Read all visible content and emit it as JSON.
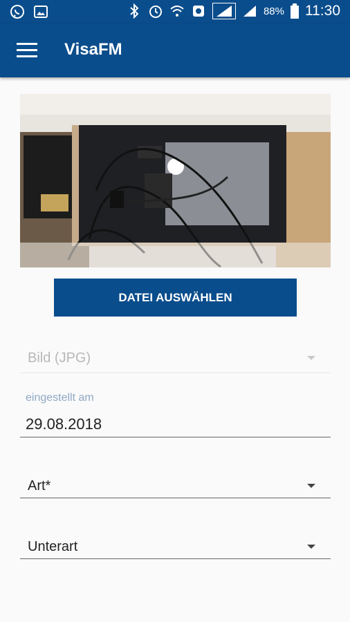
{
  "status_bar": {
    "battery": "88%",
    "time": "11:30",
    "icons": [
      "whatsapp-icon",
      "gallery-icon",
      "bluetooth-icon",
      "alarm-icon",
      "wifi-icon",
      "nfc-icon",
      "signal-icon",
      "signal-icon",
      "battery-icon"
    ]
  },
  "app_bar": {
    "title": "VisaFM"
  },
  "photo": {
    "description_icon": "image-laptop-photo"
  },
  "file_button": {
    "label": "DATEI AUSWÄHLEN"
  },
  "fields": {
    "file_type": {
      "value": "Bild (JPG)"
    },
    "date": {
      "label": "eingestellt am",
      "value": "29.08.2018"
    },
    "art": {
      "value": "Art*"
    },
    "unterart": {
      "value": "Unterart"
    }
  },
  "colors": {
    "primary": "#0a4d8c",
    "accent_label": "#8fa8c4"
  }
}
